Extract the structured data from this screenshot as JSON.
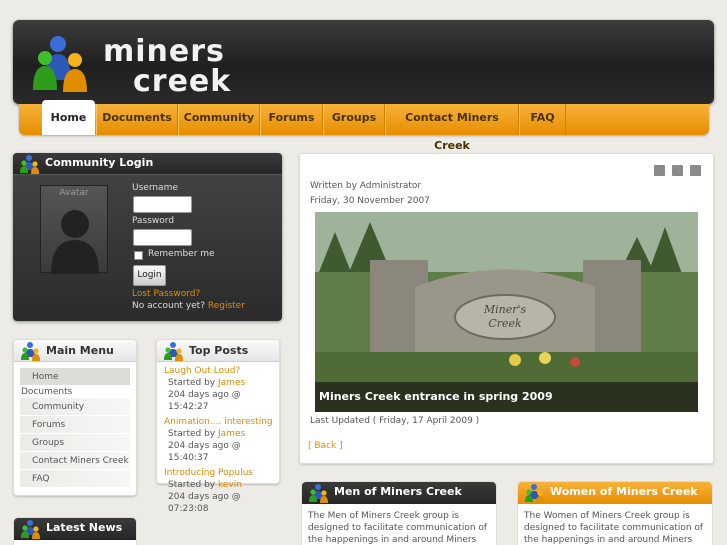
{
  "header": {
    "logo_line1": "miners",
    "logo_line2": "creek"
  },
  "nav": {
    "items": [
      {
        "label": "Home",
        "active": true
      },
      {
        "label": "Documents"
      },
      {
        "label": "Community"
      },
      {
        "label": "Forums"
      },
      {
        "label": "Groups"
      },
      {
        "label": "Contact Miners Creek"
      },
      {
        "label": "FAQ"
      }
    ]
  },
  "login": {
    "title": "Community Login",
    "avatar_label": "Avatar",
    "username_label": "Username",
    "password_label": "Password",
    "remember_label": "Remember me",
    "button_label": "Login",
    "lost_password": "Lost Password?",
    "no_account": "No account yet?",
    "register": "Register"
  },
  "main_menu": {
    "title": "Main Menu",
    "items": {
      "home": "Home",
      "documents": "Documents",
      "community": "Community",
      "forums": "Forums",
      "groups": "Groups",
      "contact": "Contact Miners Creek",
      "faq": "FAQ"
    }
  },
  "top_posts": {
    "title": "Top Posts",
    "posts": [
      {
        "title": "Laugh Out Loud?",
        "started_by": "Started by",
        "author": "James",
        "meta": "204 days ago @ 15:42:27"
      },
      {
        "title": "Animation.... interesting",
        "started_by": "Started by",
        "author": "James",
        "meta": "204 days ago @ 15:40:37"
      },
      {
        "title": "Introducing Populus",
        "started_by": "Started by",
        "author": "kevin",
        "meta": "204 days ago @ 07:23:08"
      }
    ]
  },
  "latest_news": {
    "title": "Latest News"
  },
  "article": {
    "written_by": "Written by Administrator",
    "date": "Friday, 30 November 2007",
    "photo_caption": "Miners Creek entrance in spring 2009",
    "sign_text_1": "Miner's",
    "sign_text_2": "Creek",
    "last_updated": "Last Updated ( Friday, 17 April 2009 )",
    "back": "[ Back ]"
  },
  "men": {
    "title": "Men of Miners Creek",
    "text": "The Men of Miners Creek group is designed to facilitate communication of the happenings in and around Miners Creek"
  },
  "women": {
    "title": "Women of Miners Creek",
    "text": "The Women of Miners Creek group is designed to facilitate communication of the happenings in and around Miners Creek"
  },
  "colors": {
    "accent": "#e68d00",
    "dark": "#2b2b2b",
    "background": "#ecebe6"
  }
}
